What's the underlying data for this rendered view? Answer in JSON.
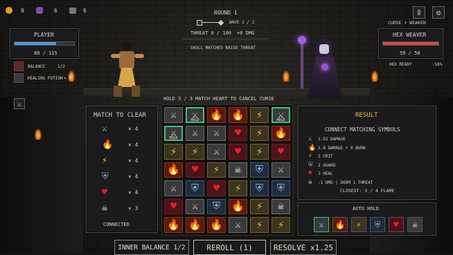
{
  "currencies": [
    {
      "icon": "coin-icon",
      "value": "0",
      "color": "#e0a020"
    },
    {
      "icon": "skull-gem-icon",
      "value": "6",
      "color": "#a060c0"
    },
    {
      "icon": "ore-icon",
      "value": "6",
      "color": "#9a9a9a"
    }
  ],
  "round": {
    "label": "ROUND 1",
    "wave": "WAVE 1 / 2",
    "threat": "THREAT 0 / 100",
    "dmg": "+0 DMG",
    "hint": "SKULL MATCHES RAISE THREAT"
  },
  "player": {
    "name": "PLAYER",
    "hp": "80 / 115",
    "hp_fraction": 0.7,
    "balance_label": "BALANCE",
    "balance_value": "1/2",
    "potion_label": "HEALING POTION",
    "potion_value": "× 0"
  },
  "enemy": {
    "curse": "CURSE + WEAKEN",
    "name": "HEX WEAVER",
    "hp": "58 / 58",
    "hp_fraction": 1.0,
    "status": "HEX READY",
    "status_pct": "-58%"
  },
  "board_header": {
    "hold": "HOLD 3 / 3",
    "hint": "MATCH HEART TO CANCEL CURSE"
  },
  "match_panel": {
    "title": "MATCH TO CLEAR",
    "rows": [
      {
        "icon": "sword",
        "count": "× 4"
      },
      {
        "icon": "fire",
        "count": "× 4"
      },
      {
        "icon": "bolt",
        "count": "× 4"
      },
      {
        "icon": "shield",
        "count": "× 4"
      },
      {
        "icon": "heart",
        "count": "× 4"
      },
      {
        "icon": "skull",
        "count": "× 3"
      }
    ],
    "status": "CONNECTED"
  },
  "board": [
    [
      "sword",
      "sword",
      "fire",
      "fire",
      "bolt",
      "sword"
    ],
    [
      "sword",
      "sword",
      "sword",
      "heart",
      "bolt",
      "fire"
    ],
    [
      "bolt",
      "bolt",
      "sword",
      "heart",
      "bolt",
      "heart"
    ],
    [
      "fire",
      "heart",
      "bolt",
      "skull",
      "shield",
      "sword"
    ],
    [
      "sword",
      "shield",
      "heart",
      "bolt",
      "shield",
      "shield"
    ],
    [
      "heart",
      "sword",
      "shield",
      "fire",
      "bolt",
      "skull"
    ],
    [
      "fire",
      "fire",
      "fire",
      "sword",
      "bolt",
      "bolt"
    ]
  ],
  "hold_flags": [
    [
      0,
      1,
      0,
      0,
      0,
      1
    ],
    [
      1,
      0,
      0,
      0,
      0,
      0
    ],
    [
      0,
      0,
      0,
      0,
      0,
      0
    ],
    [
      0,
      0,
      0,
      0,
      0,
      0
    ],
    [
      0,
      0,
      0,
      0,
      0,
      0
    ],
    [
      0,
      0,
      0,
      0,
      0,
      0
    ],
    [
      0,
      0,
      0,
      0,
      0,
      0
    ]
  ],
  "hold_tag": "HOLD",
  "result": {
    "title": "RESULT",
    "subtitle": "CONNECT MATCHING SYMBOLS",
    "rows": [
      {
        "icon": "sword",
        "text": "1.55 DAMAGE"
      },
      {
        "icon": "fire",
        "text": "1.8 DAMAGE + 0 BURN"
      },
      {
        "icon": "bolt",
        "text": "2 CRIT"
      },
      {
        "icon": "shield",
        "text": "2 GUARD"
      },
      {
        "icon": "heart",
        "text": "1 HEAL"
      },
      {
        "icon": "skull",
        "text": "-1 DMG | DOOM 1 THREAT"
      }
    ],
    "closest": "CLOSEST: 3 / 4 FLAME"
  },
  "auto_hold": {
    "title": "AUTO HOLD",
    "icons": [
      "sword",
      "fire",
      "bolt",
      "shield",
      "heart",
      "skull"
    ]
  },
  "bottom": {
    "balance": "INNER BALANCE  1/2",
    "reroll": "REROLL (1)",
    "resolve": "RESOLVE  x1.25"
  },
  "tile_colors": {
    "sword": "#cfcfcf",
    "fire": "#ff6a1a",
    "bolt": "#f2c428",
    "shield": "#8fb0d8",
    "heart": "#e0222a",
    "skull": "#eeeeee"
  },
  "tile_bgs": {
    "sword": "#3a3a3c",
    "fire": "#5a1a10",
    "bolt": "#3a3420",
    "shield": "#1e2c3c",
    "heart": "#4a1418",
    "skull": "#3a3a3a"
  },
  "glyphs": {
    "sword": "⚔",
    "fire": "🔥",
    "bolt": "⚡",
    "shield": "⛨",
    "heart": "♥",
    "skull": "☠"
  }
}
